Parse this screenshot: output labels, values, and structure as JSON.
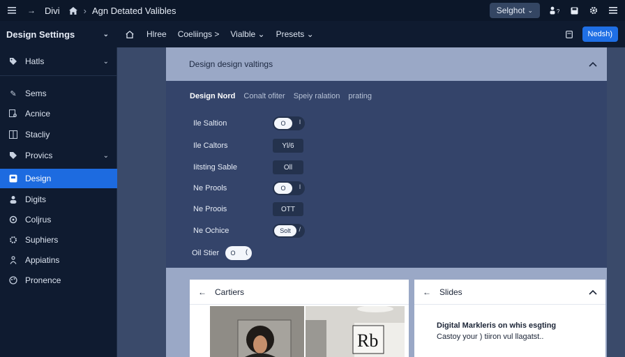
{
  "topbar": {
    "app": "Divi",
    "title": "Agn Detated Valibles",
    "button": "Selghot",
    "button_chev": "⌄"
  },
  "navbar": {
    "title": "Design Settings",
    "links": [
      "Hlree",
      "Coeliings >",
      "Vialble ⌄",
      "Presets ⌄"
    ],
    "primary": "Nedsh)"
  },
  "sidebar": {
    "items": [
      {
        "label": "Hatls"
      },
      {
        "label": "Sems"
      },
      {
        "label": "Acnice"
      },
      {
        "label": "Stacliy"
      },
      {
        "label": "Provics"
      },
      {
        "label": "Design"
      },
      {
        "label": "Digits"
      },
      {
        "label": "Coljrus"
      },
      {
        "label": "Suphiers"
      },
      {
        "label": "Appiatins"
      },
      {
        "label": "Pronence"
      }
    ]
  },
  "panel": {
    "header": "Design design valtings",
    "tabs": [
      "Design Nord",
      "Conalt ofiter",
      "Speiy ralation",
      "prating"
    ],
    "rows": [
      {
        "label": "Ile Saltion",
        "control": "toggle",
        "value": "O",
        "end": "l"
      },
      {
        "label": "Ile Caltors",
        "control": "field",
        "value": "Yl/6"
      },
      {
        "label": "Iitsting Sable",
        "control": "field",
        "value": "Oll"
      },
      {
        "label": "Ne Prools",
        "control": "toggle",
        "value": "O",
        "end": "l"
      },
      {
        "label": "Ne Proois",
        "control": "field",
        "value": "OTT"
      },
      {
        "label": "Ne Ochice",
        "control": "toggle",
        "value": "Solt",
        "end": "/"
      },
      {
        "label": "Oil Stier",
        "control": "toggle",
        "value": "O",
        "end": "("
      }
    ]
  },
  "cards": {
    "left": {
      "title": "Cartiers"
    },
    "right": {
      "title": "Slides",
      "line1": "Digital Markleris on whis esgting",
      "line2": "Castoy your ) tiiron vul llagatst.."
    }
  },
  "thumb_text": "Rb",
  "colors": {
    "accent": "#1d6be0",
    "sidebar_bg": "#0f1b30",
    "panel_bg": "#34446a"
  }
}
